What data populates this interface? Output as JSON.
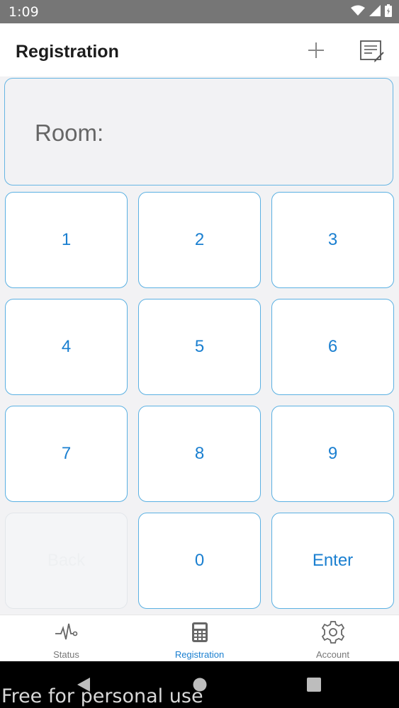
{
  "status_bar": {
    "time": "1:09"
  },
  "app_bar": {
    "title": "Registration"
  },
  "room": {
    "label": "Room:"
  },
  "keypad": {
    "keys": [
      "1",
      "2",
      "3",
      "4",
      "5",
      "6",
      "7",
      "8",
      "9",
      "Back",
      "0",
      "Enter"
    ]
  },
  "bottom_nav": {
    "items": [
      {
        "label": "Status",
        "icon": "pulse-icon"
      },
      {
        "label": "Registration",
        "icon": "calculator-icon"
      },
      {
        "label": "Account",
        "icon": "gear-icon"
      }
    ],
    "active": "Registration"
  },
  "watermark": "Free for personal use",
  "colors": {
    "accent": "#1a7fd0",
    "key_border": "#5ab0e2",
    "status_bar": "#767676",
    "background": "#f2f2f4"
  }
}
